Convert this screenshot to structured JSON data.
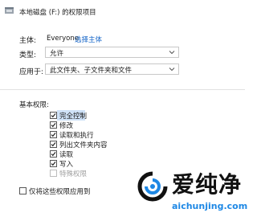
{
  "window": {
    "title": "本地磁盘 (F:) 的权限项目"
  },
  "principal": {
    "label": "主体:",
    "value": "Everyone",
    "link": "选择主体"
  },
  "type": {
    "label": "类型:",
    "value": "允许"
  },
  "applies_to": {
    "label": "应用于:",
    "value": "此文件夹、子文件夹和文件"
  },
  "basic_permissions": {
    "heading": "基本权限:",
    "items": [
      {
        "label": "完全控制",
        "checked": true,
        "enabled": true
      },
      {
        "label": "修改",
        "checked": true,
        "enabled": true
      },
      {
        "label": "读取和执行",
        "checked": true,
        "enabled": true
      },
      {
        "label": "列出文件夹内容",
        "checked": true,
        "enabled": true
      },
      {
        "label": "读取",
        "checked": true,
        "enabled": true
      },
      {
        "label": "写入",
        "checked": true,
        "enabled": true
      },
      {
        "label": "特殊权限",
        "checked": false,
        "enabled": false
      }
    ]
  },
  "apply_only": {
    "label": "仅将这些权限应用到",
    "checked": false
  },
  "watermark": {
    "title": "爱纯净",
    "url": "aichunjing.com"
  },
  "colors": {
    "link": "#1565c8",
    "highlight": "#cfe2f7",
    "watermark_url": "#1e88e5"
  }
}
